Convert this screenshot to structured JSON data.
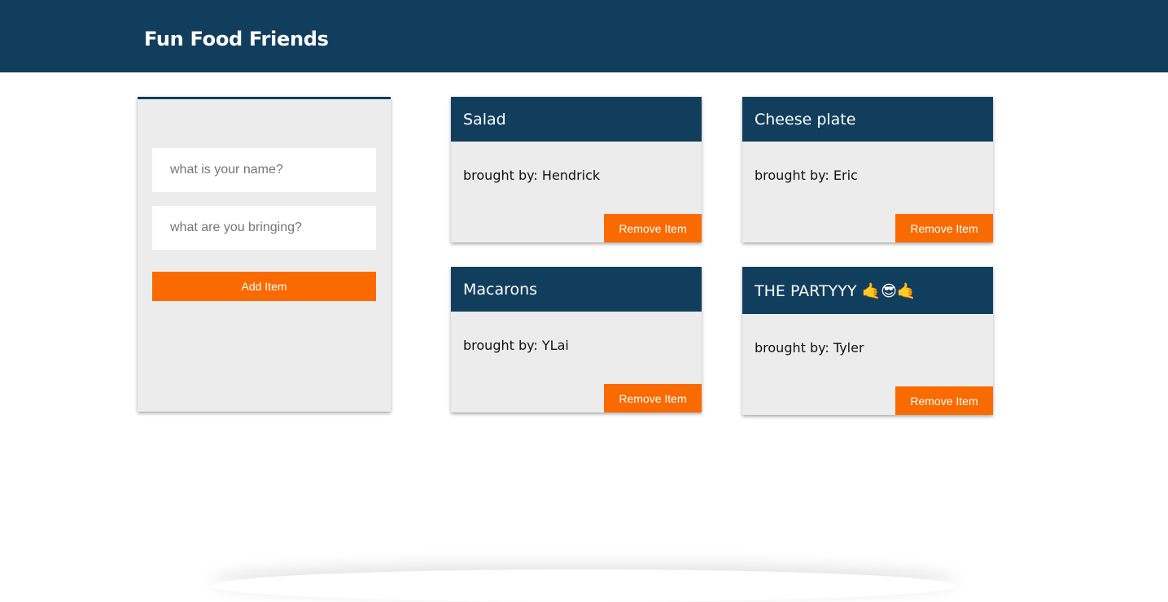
{
  "header": {
    "title": "Fun Food Friends"
  },
  "form": {
    "name_placeholder": "what is your name?",
    "item_placeholder": "what are you bringing?",
    "add_label": "Add Item"
  },
  "items": [
    {
      "title": "Salad",
      "brought_by": "brought by: Hendrick",
      "remove_label": "Remove Item"
    },
    {
      "title": "Cheese plate",
      "brought_by": "brought by: Eric",
      "remove_label": "Remove Item"
    },
    {
      "title": "Macarons",
      "brought_by": "brought by: YLai",
      "remove_label": "Remove Item"
    },
    {
      "title": "THE PARTYYY 🤙😎🤙",
      "brought_by": "brought by: Tyler",
      "remove_label": "Remove Item"
    }
  ],
  "colors": {
    "header": "#123e5e",
    "accent": "#f96a00",
    "panel": "#ececec"
  }
}
